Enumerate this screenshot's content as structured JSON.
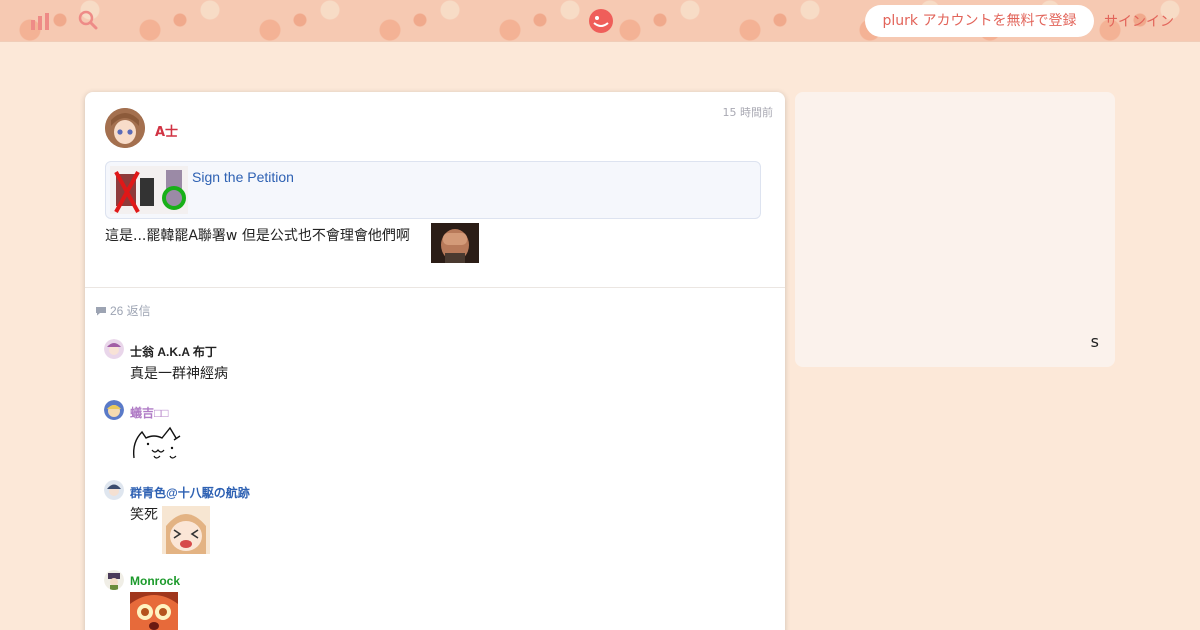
{
  "topbar": {
    "register_label": "plurk アカウントを無料で登録",
    "signin_label": "サインイン",
    "colors": {
      "accent": "#e2645a",
      "bar": "#f6c9b2"
    }
  },
  "post": {
    "time": "15 時間前",
    "author": "A士",
    "author_color": "#d13343",
    "link_title": "Sign the Petition",
    "text": "這是...罷韓罷A聯署w 但是公式也不會理會他們啊"
  },
  "replies": {
    "count_label": "26 返信",
    "items": [
      {
        "name": "士翁 A.K.A 布丁",
        "name_color": "#222222",
        "text": "真是一群神經病"
      },
      {
        "name": "蟻吉□□",
        "name_color": "#b07cc6",
        "text": ""
      },
      {
        "name": "群青色@十八駆の航跡",
        "name_color": "#2e61b3",
        "text": "笑死"
      },
      {
        "name": "Monrock",
        "name_color": "#1c9a2b",
        "text": ""
      }
    ]
  },
  "side": {
    "text": "s"
  },
  "page": {
    "background": "#fce8d8"
  }
}
